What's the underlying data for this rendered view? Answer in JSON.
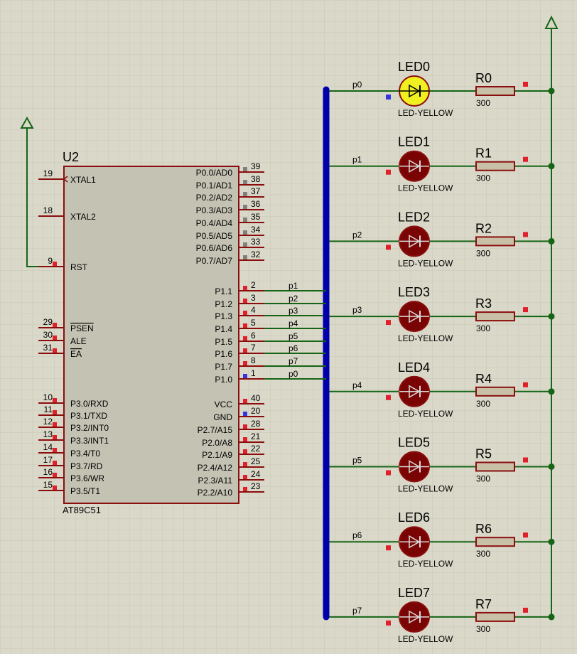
{
  "colors": {
    "background": "#d9d8c9",
    "grid": "#c9c8b8",
    "bus": "#0000aa",
    "wire": "#156515",
    "component_outline": "#8b0e0e",
    "chip_fill": "#c3c2b3",
    "marker_red": "#e0202a",
    "marker_blue": "#3535e0",
    "marker_gray": "#808080",
    "led_off": "#7a0404",
    "led_on": "#f0f020",
    "resistor_fill": "#c9c0a8"
  },
  "chip": {
    "ref": "U2",
    "part": "AT89C51",
    "left_pins": [
      {
        "num": "19",
        "name": "XTAL1"
      },
      {
        "num": "18",
        "name": "XTAL2"
      },
      {
        "num": "9",
        "name": "RST"
      },
      {
        "num": "29",
        "name": "PSEN",
        "overline": true
      },
      {
        "num": "30",
        "name": "ALE"
      },
      {
        "num": "31",
        "name": "EA",
        "overline": true
      },
      {
        "num": "10",
        "name": "P3.0/RXD"
      },
      {
        "num": "11",
        "name": "P3.1/TXD"
      },
      {
        "num": "12",
        "name": "P3.2/INT0"
      },
      {
        "num": "13",
        "name": "P3.3/INT1"
      },
      {
        "num": "14",
        "name": "P3.4/T0"
      },
      {
        "num": "17",
        "name": "P3.7/RD"
      },
      {
        "num": "16",
        "name": "P3.6/WR"
      },
      {
        "num": "15",
        "name": "P3.5/T1"
      }
    ],
    "right_pins": [
      {
        "num": "39",
        "name": "P0.0/AD0"
      },
      {
        "num": "38",
        "name": "P0.1/AD1"
      },
      {
        "num": "37",
        "name": "P0.2/AD2"
      },
      {
        "num": "36",
        "name": "P0.3/AD3"
      },
      {
        "num": "35",
        "name": "P0.4/AD4"
      },
      {
        "num": "34",
        "name": "P0.5/AD5"
      },
      {
        "num": "33",
        "name": "P0.6/AD6"
      },
      {
        "num": "32",
        "name": "P0.7/AD7"
      },
      {
        "num": "2",
        "name": "P1.1"
      },
      {
        "num": "3",
        "name": "P1.2"
      },
      {
        "num": "4",
        "name": "P1.3"
      },
      {
        "num": "5",
        "name": "P1.4"
      },
      {
        "num": "6",
        "name": "P1.5"
      },
      {
        "num": "7",
        "name": "P1.6"
      },
      {
        "num": "8",
        "name": "P1.7"
      },
      {
        "num": "1",
        "name": "P1.0"
      },
      {
        "num": "40",
        "name": "VCC"
      },
      {
        "num": "20",
        "name": "GND"
      },
      {
        "num": "28",
        "name": "P2.7/A15"
      },
      {
        "num": "21",
        "name": "P2.0/A8"
      },
      {
        "num": "22",
        "name": "P2.1/A9"
      },
      {
        "num": "25",
        "name": "P2.4/A12"
      },
      {
        "num": "24",
        "name": "P2.3/A11"
      },
      {
        "num": "23",
        "name": "P2.2/A10"
      }
    ],
    "port_wire_labels": [
      "p1",
      "p2",
      "p3",
      "p4",
      "p5",
      "p6",
      "p7",
      "p0"
    ]
  },
  "leds": [
    {
      "name": "LED0",
      "type": "LED-YELLOW",
      "net": "p0",
      "lit": true,
      "resistor": "R0",
      "value": "300"
    },
    {
      "name": "LED1",
      "type": "LED-YELLOW",
      "net": "p1",
      "lit": false,
      "resistor": "R1",
      "value": "300"
    },
    {
      "name": "LED2",
      "type": "LED-YELLOW",
      "net": "p2",
      "lit": false,
      "resistor": "R2",
      "value": "300"
    },
    {
      "name": "LED3",
      "type": "LED-YELLOW",
      "net": "p3",
      "lit": false,
      "resistor": "R3",
      "value": "300"
    },
    {
      "name": "LED4",
      "type": "LED-YELLOW",
      "net": "p4",
      "lit": false,
      "resistor": "R4",
      "value": "300"
    },
    {
      "name": "LED5",
      "type": "LED-YELLOW",
      "net": "p5",
      "lit": false,
      "resistor": "R5",
      "value": "300"
    },
    {
      "name": "LED6",
      "type": "LED-YELLOW",
      "net": "p6",
      "lit": false,
      "resistor": "R6",
      "value": "300"
    },
    {
      "name": "LED7",
      "type": "LED-YELLOW",
      "net": "p7",
      "lit": false,
      "resistor": "R7",
      "value": "300"
    }
  ]
}
